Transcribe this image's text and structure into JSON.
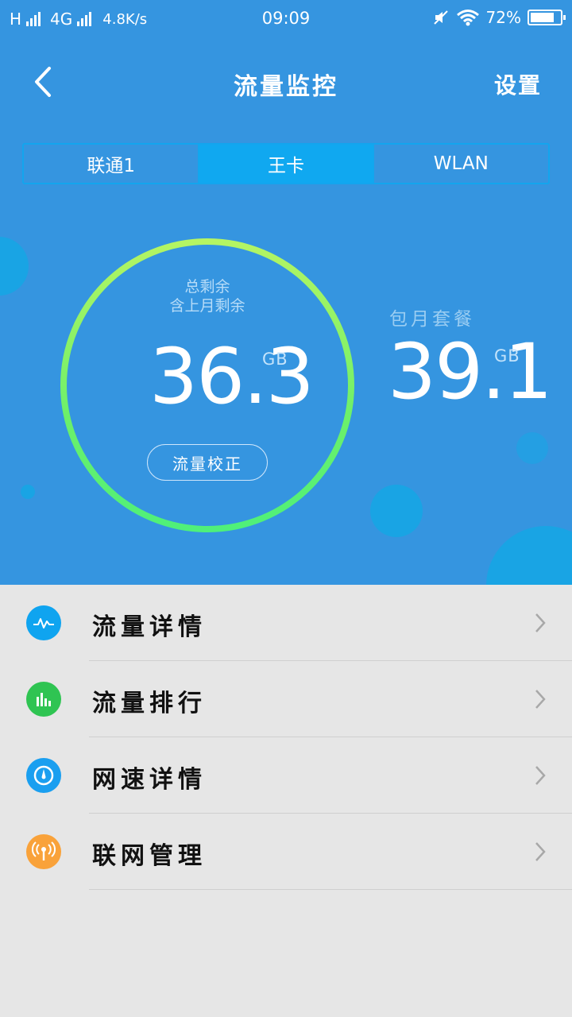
{
  "status_bar": {
    "network_left": "H",
    "network_type": "4G",
    "speed": "4.8K/s",
    "time": "09:09",
    "battery": "72%",
    "battery_level": 0.72
  },
  "header": {
    "title": "流量监控",
    "settings_label": "设置"
  },
  "tabs": [
    {
      "label": "联通1",
      "active": false
    },
    {
      "label": "王卡",
      "active": true
    },
    {
      "label": "WLAN",
      "active": false
    }
  ],
  "gauge": {
    "label_line1": "总剩余",
    "label_line2": "含上月剩余",
    "value": "36.3",
    "unit": "GB",
    "calibrate_label": "流量校正"
  },
  "plan": {
    "label": "包月套餐",
    "value": "39.1",
    "unit": "GB"
  },
  "menu": [
    {
      "label": "流量详情",
      "icon": "pulse-icon",
      "color": "#0fa4f0"
    },
    {
      "label": "流量排行",
      "icon": "bar-chart-icon",
      "color": "#2fc452"
    },
    {
      "label": "网速详情",
      "icon": "speedometer-icon",
      "color": "#1a9ff0"
    },
    {
      "label": "联网管理",
      "icon": "antenna-icon",
      "color": "#f9a23a"
    }
  ],
  "colors": {
    "header_bg": "#3595e0",
    "active_tab": "#10a8f0",
    "gauge_ring_top": "#b6f563",
    "gauge_ring_bottom": "#4ef07a"
  }
}
